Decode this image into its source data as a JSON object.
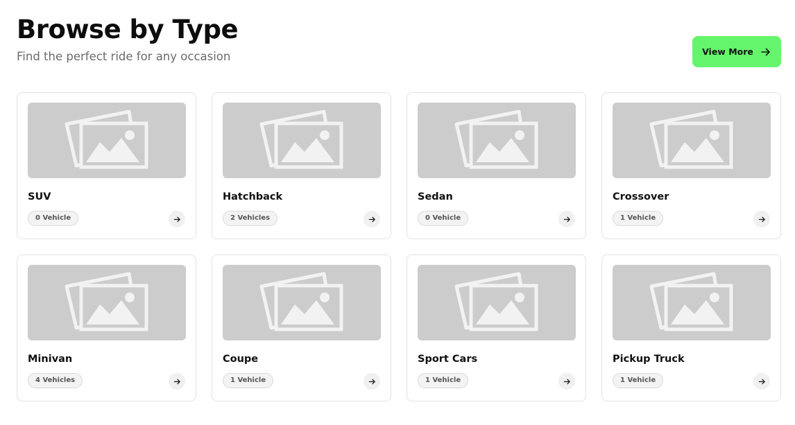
{
  "header": {
    "title": "Browse by Type",
    "subtitle": "Find the perfect ride for any occasion",
    "view_more_label": "View More",
    "view_more_icon": "arrow-right-icon",
    "accent_color": "#65f56c"
  },
  "categories": [
    {
      "name": "SUV",
      "count": "0 Vehicle",
      "image_icon": "image-placeholder-icon"
    },
    {
      "name": "Hatchback",
      "count": "2 Vehicles",
      "image_icon": "image-placeholder-icon"
    },
    {
      "name": "Sedan",
      "count": "0 Vehicle",
      "image_icon": "image-placeholder-icon"
    },
    {
      "name": "Crossover",
      "count": "1 Vehicle",
      "image_icon": "image-placeholder-icon"
    },
    {
      "name": "Minivan",
      "count": "4 Vehicles",
      "image_icon": "image-placeholder-icon"
    },
    {
      "name": "Coupe",
      "count": "1 Vehicle",
      "image_icon": "image-placeholder-icon"
    },
    {
      "name": "Sport Cars",
      "count": "1 Vehicle",
      "image_icon": "image-placeholder-icon"
    },
    {
      "name": "Pickup Truck",
      "count": "1 Vehicle",
      "image_icon": "image-placeholder-icon"
    }
  ]
}
